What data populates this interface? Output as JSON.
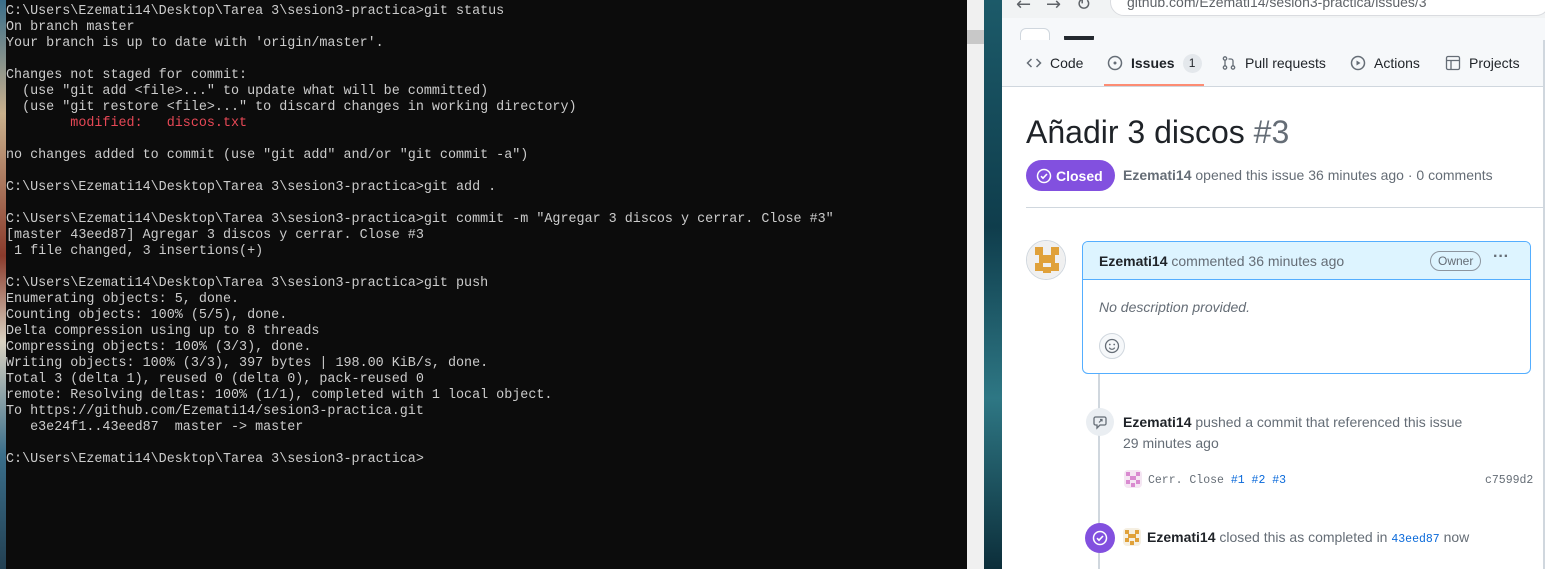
{
  "terminal": {
    "lines": [
      {
        "text": "C:\\Users\\Ezemati14\\Desktop\\Tarea 3\\sesion3-practica>git status",
        "color": "normal"
      },
      {
        "text": "On branch master",
        "color": "normal"
      },
      {
        "text": "Your branch is up to date with 'origin/master'.",
        "color": "normal"
      },
      {
        "text": "",
        "color": "normal"
      },
      {
        "text": "Changes not staged for commit:",
        "color": "normal"
      },
      {
        "text": "  (use \"git add <file>...\" to update what will be committed)",
        "color": "normal"
      },
      {
        "text": "  (use \"git restore <file>...\" to discard changes in working directory)",
        "color": "normal"
      },
      {
        "text": "        modified:   discos.txt",
        "color": "red"
      },
      {
        "text": "",
        "color": "normal"
      },
      {
        "text": "no changes added to commit (use \"git add\" and/or \"git commit -a\")",
        "color": "normal"
      },
      {
        "text": "",
        "color": "normal"
      },
      {
        "text": "C:\\Users\\Ezemati14\\Desktop\\Tarea 3\\sesion3-practica>git add .",
        "color": "normal"
      },
      {
        "text": "",
        "color": "normal"
      },
      {
        "text": "C:\\Users\\Ezemati14\\Desktop\\Tarea 3\\sesion3-practica>git commit -m \"Agregar 3 discos y cerrar. Close #3\"",
        "color": "normal"
      },
      {
        "text": "[master 43eed87] Agregar 3 discos y cerrar. Close #3",
        "color": "normal"
      },
      {
        "text": " 1 file changed, 3 insertions(+)",
        "color": "normal"
      },
      {
        "text": "",
        "color": "normal"
      },
      {
        "text": "C:\\Users\\Ezemati14\\Desktop\\Tarea 3\\sesion3-practica>git push",
        "color": "normal"
      },
      {
        "text": "Enumerating objects: 5, done.",
        "color": "normal"
      },
      {
        "text": "Counting objects: 100% (5/5), done.",
        "color": "normal"
      },
      {
        "text": "Delta compression using up to 8 threads",
        "color": "normal"
      },
      {
        "text": "Compressing objects: 100% (3/3), done.",
        "color": "normal"
      },
      {
        "text": "Writing objects: 100% (3/3), 397 bytes | 198.00 KiB/s, done.",
        "color": "normal"
      },
      {
        "text": "Total 3 (delta 1), reused 0 (delta 0), pack-reused 0",
        "color": "normal"
      },
      {
        "text": "remote: Resolving deltas: 100% (1/1), completed with 1 local object.",
        "color": "normal"
      },
      {
        "text": "To https://github.com/Ezemati14/sesion3-practica.git",
        "color": "normal"
      },
      {
        "text": "   e3e24f1..43eed87  master -> master",
        "color": "normal"
      },
      {
        "text": "",
        "color": "normal"
      },
      {
        "text": "C:\\Users\\Ezemati14\\Desktop\\Tarea 3\\sesion3-practica>",
        "color": "normal"
      }
    ]
  },
  "browser": {
    "url": "github.com/Ezemati14/sesion3-practica/issues/3",
    "tabs": [
      {
        "label": "Code",
        "icon": "code-icon"
      },
      {
        "label": "Issues",
        "icon": "issue-opened-icon",
        "count": "1",
        "active": true
      },
      {
        "label": "Pull requests",
        "icon": "git-pull-request-icon"
      },
      {
        "label": "Actions",
        "icon": "play-icon"
      },
      {
        "label": "Projects",
        "icon": "table-icon"
      }
    ],
    "issue": {
      "title": "Añadir 3 discos",
      "number": "#3",
      "state": "Closed",
      "author": "Ezemati14",
      "meta_rest": "opened this issue 36 minutes ago · 0 comments"
    },
    "comment": {
      "author": "Ezemati14",
      "action": "commented 36 minutes ago",
      "badge": "Owner",
      "body": "No description provided."
    },
    "events": {
      "push_author": "Ezemati14",
      "push_text": "pushed a commit that referenced this issue",
      "push_time": "29 minutes ago",
      "commit_msg": "Cerr. Close",
      "commit_refs": [
        "#1",
        "#2",
        "#3"
      ],
      "commit_sha": "c7599d2",
      "closed_author": "Ezemati14",
      "closed_text": "closed this as completed in",
      "closed_sha": "43eed87",
      "closed_time": "now"
    },
    "colors": {
      "closed_purple": "#8250df",
      "link_blue": "#0969da",
      "comment_border": "#54aeff",
      "tab_underline": "#fd8c73"
    }
  }
}
